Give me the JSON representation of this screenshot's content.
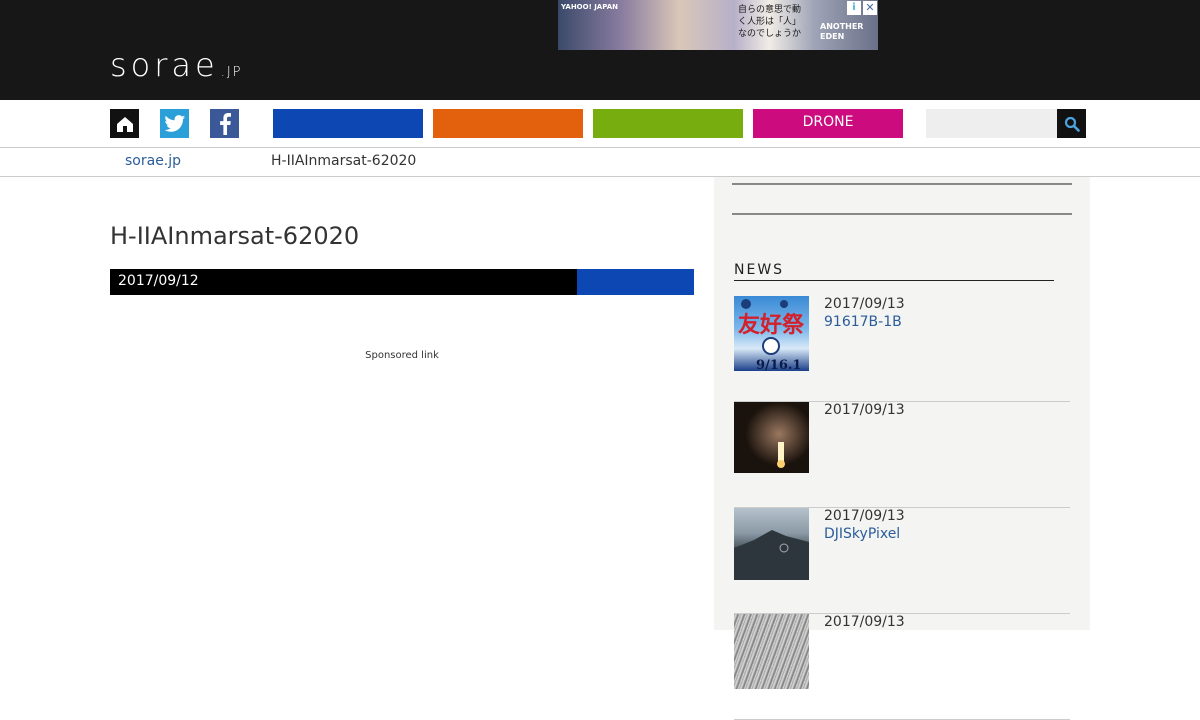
{
  "header": {
    "logo": "sorae",
    "logo_suffix": ".JP",
    "ad": {
      "brand": "YAHOO! JAPAN",
      "copy": "自らの意思で動く人形は「人」なのでしょうか",
      "game": "ANOTHER EDEN",
      "close": "✕",
      "info": "i"
    }
  },
  "nav": {
    "categories": [
      "",
      "",
      "",
      "DRONE"
    ],
    "colors": [
      "#0c47b3",
      "#e3600d",
      "#78ad0f",
      "#cc0b7f"
    ],
    "search_placeholder": "",
    "icons": [
      "home-icon",
      "twitter-icon",
      "facebook-icon",
      "search-icon"
    ]
  },
  "breadcrumb": {
    "home": "sorae.jp",
    "current": "H-IIAInmarsat-62020"
  },
  "article": {
    "title": "H-IIAInmarsat-62020",
    "date": "2017/09/12",
    "sponsored": "Sponsored link"
  },
  "sidebar": {
    "news_heading": "NEWS",
    "items": [
      {
        "date": "2017/09/13",
        "title": "91617B-1B",
        "thumb_text": "友好祭",
        "thumb_sub": "9/16.1"
      },
      {
        "date": "2017/09/13",
        "title": ""
      },
      {
        "date": "2017/09/13",
        "title": "DJISkyPixel"
      },
      {
        "date": "2017/09/13",
        "title": ""
      }
    ]
  }
}
